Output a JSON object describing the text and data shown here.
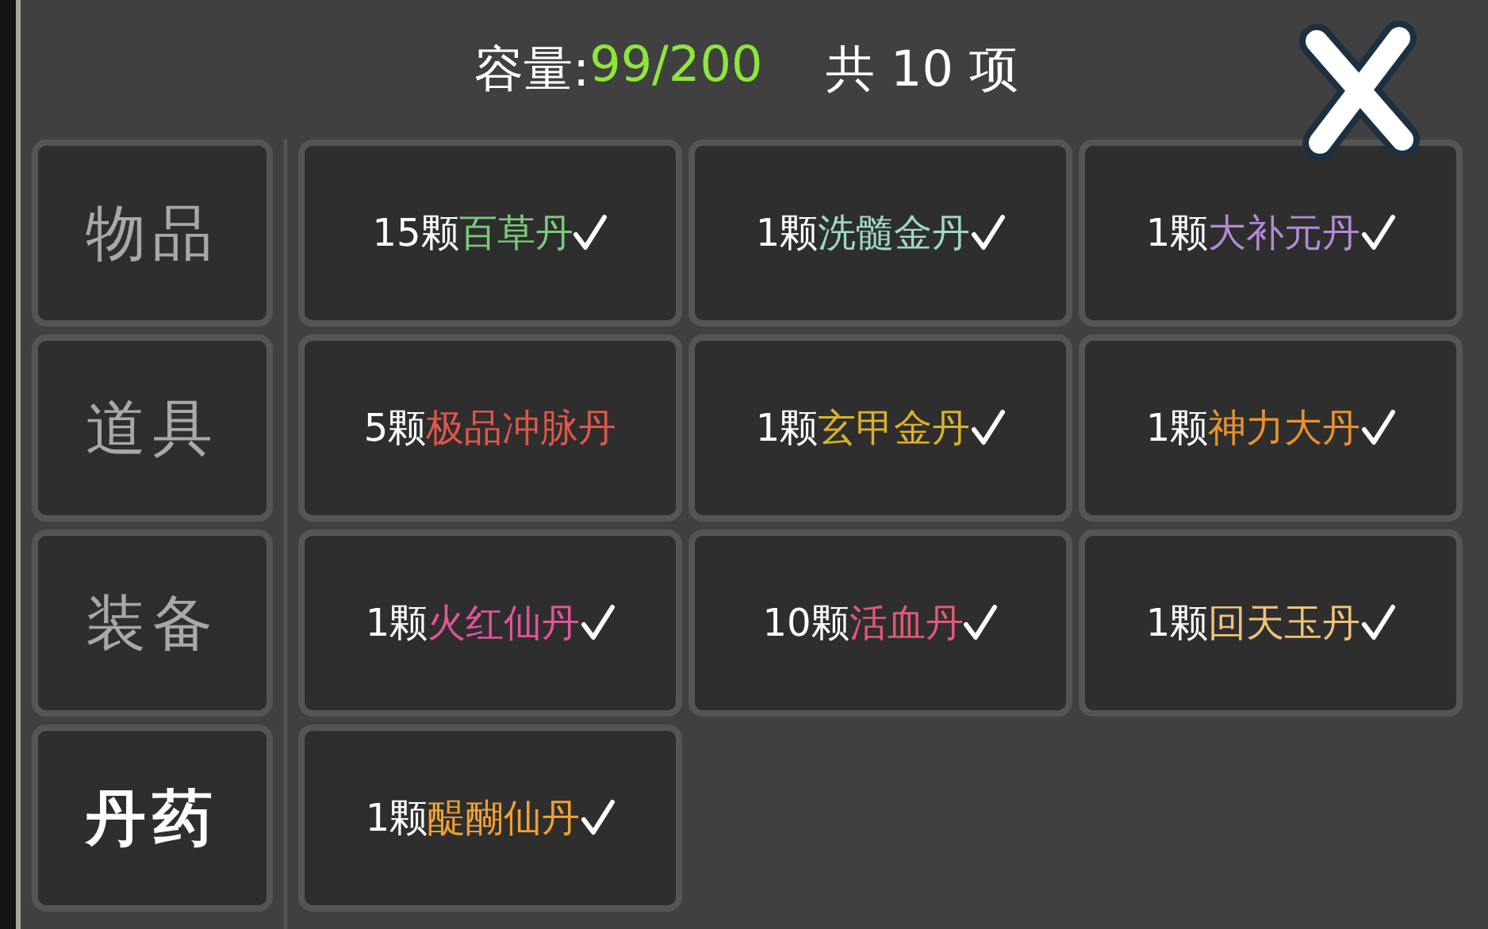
{
  "header": {
    "capacity_label": "容量:",
    "capacity_value": "99/200",
    "total": "共 10 项"
  },
  "tabs": [
    {
      "label": "物品",
      "selected": false
    },
    {
      "label": "道具",
      "selected": false
    },
    {
      "label": "装备",
      "selected": false
    },
    {
      "label": "丹药",
      "selected": true
    }
  ],
  "items": [
    {
      "count": "15颗",
      "name": "百草丹",
      "color": "#7cc97c",
      "checked": true
    },
    {
      "count": "1颗",
      "name": "洗髓金丹",
      "color": "#9fd9c0",
      "checked": true
    },
    {
      "count": "1颗",
      "name": "大补元丹",
      "color": "#b48ad6",
      "checked": true
    },
    {
      "count": "5颗",
      "name": "极品冲脉丹",
      "color": "#e0574a",
      "checked": false
    },
    {
      "count": "1颗",
      "name": "玄甲金丹",
      "color": "#d9b22a",
      "checked": true
    },
    {
      "count": "1颗",
      "name": "神力大丹",
      "color": "#e8922e",
      "checked": true
    },
    {
      "count": "1颗",
      "name": "火红仙丹",
      "color": "#e0559a",
      "checked": true
    },
    {
      "count": "10颗",
      "name": "活血丹",
      "color": "#e05a78",
      "checked": true
    },
    {
      "count": "1颗",
      "name": "回天玉丹",
      "color": "#edc27a",
      "checked": true
    },
    {
      "count": "1颗",
      "name": "醍醐仙丹",
      "color": "#f0a030",
      "checked": true
    }
  ]
}
